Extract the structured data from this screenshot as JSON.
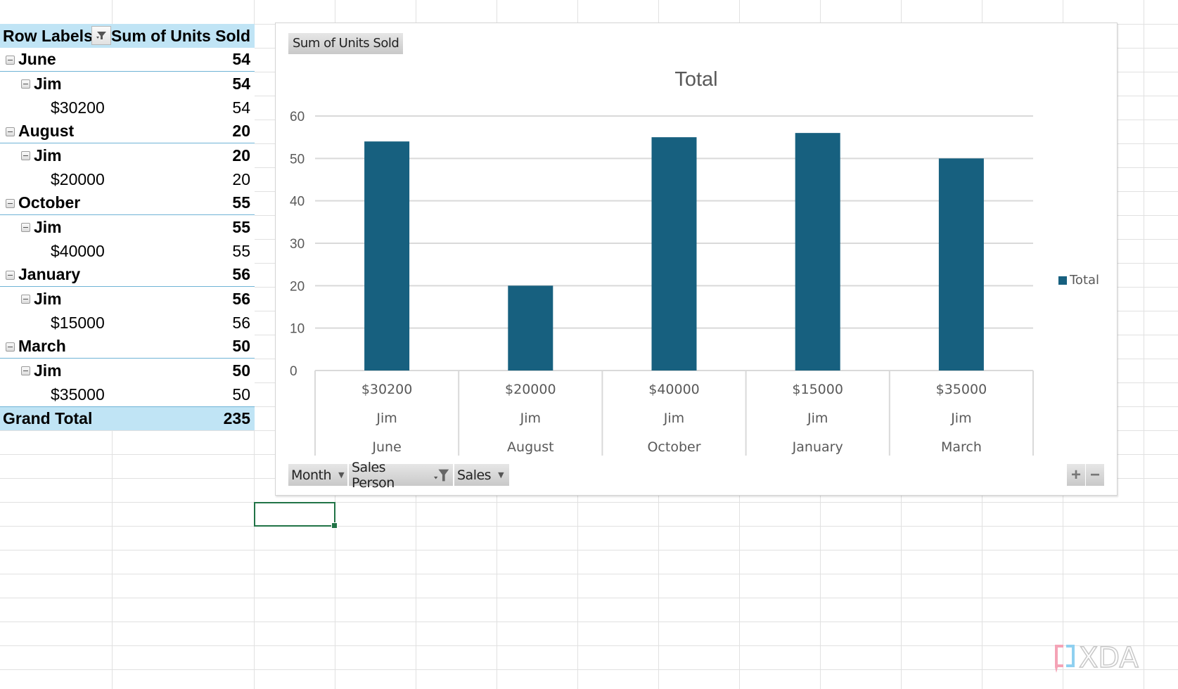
{
  "pivot": {
    "header": {
      "row_labels": "Row Labels",
      "value_header": "Sum of Units Sold"
    },
    "groups": [
      {
        "month": "June",
        "month_total": "54",
        "person": "Jim",
        "person_total": "54",
        "sales": "$30200",
        "units": "54"
      },
      {
        "month": "August",
        "month_total": "20",
        "person": "Jim",
        "person_total": "20",
        "sales": "$20000",
        "units": "20"
      },
      {
        "month": "October",
        "month_total": "55",
        "person": "Jim",
        "person_total": "55",
        "sales": "$40000",
        "units": "55"
      },
      {
        "month": "January",
        "month_total": "56",
        "person": "Jim",
        "person_total": "56",
        "sales": "$15000",
        "units": "56"
      },
      {
        "month": "March",
        "month_total": "50",
        "person": "Jim",
        "person_total": "50",
        "sales": "$35000",
        "units": "50"
      }
    ],
    "grand_total_label": "Grand Total",
    "grand_total_value": "235"
  },
  "chart_data": {
    "type": "bar",
    "title": "Total",
    "value_field_button": "Sum of Units Sold",
    "categories": [
      {
        "sales": "$30200",
        "person": "Jim",
        "month": "June"
      },
      {
        "sales": "$20000",
        "person": "Jim",
        "month": "August"
      },
      {
        "sales": "$40000",
        "person": "Jim",
        "month": "October"
      },
      {
        "sales": "$15000",
        "person": "Jim",
        "month": "January"
      },
      {
        "sales": "$35000",
        "person": "Jim",
        "month": "March"
      }
    ],
    "series": [
      {
        "name": "Total",
        "values": [
          54,
          20,
          55,
          56,
          50
        ]
      }
    ],
    "ylim": [
      0,
      60
    ],
    "yticks": [
      0,
      10,
      20,
      30,
      40,
      50,
      60
    ],
    "grid": true,
    "legend": "right",
    "bar_color": "#17607f",
    "xlabel": "",
    "ylabel": ""
  },
  "chart_ui": {
    "field_buttons": [
      {
        "label": "Month",
        "icon": "dropdown-arrow"
      },
      {
        "label": "Sales Person",
        "icon": "filter-applied"
      },
      {
        "label": "Sales",
        "icon": "dropdown-arrow"
      }
    ],
    "expand_label": "+",
    "collapse_label": "−"
  },
  "watermark": "XDA"
}
